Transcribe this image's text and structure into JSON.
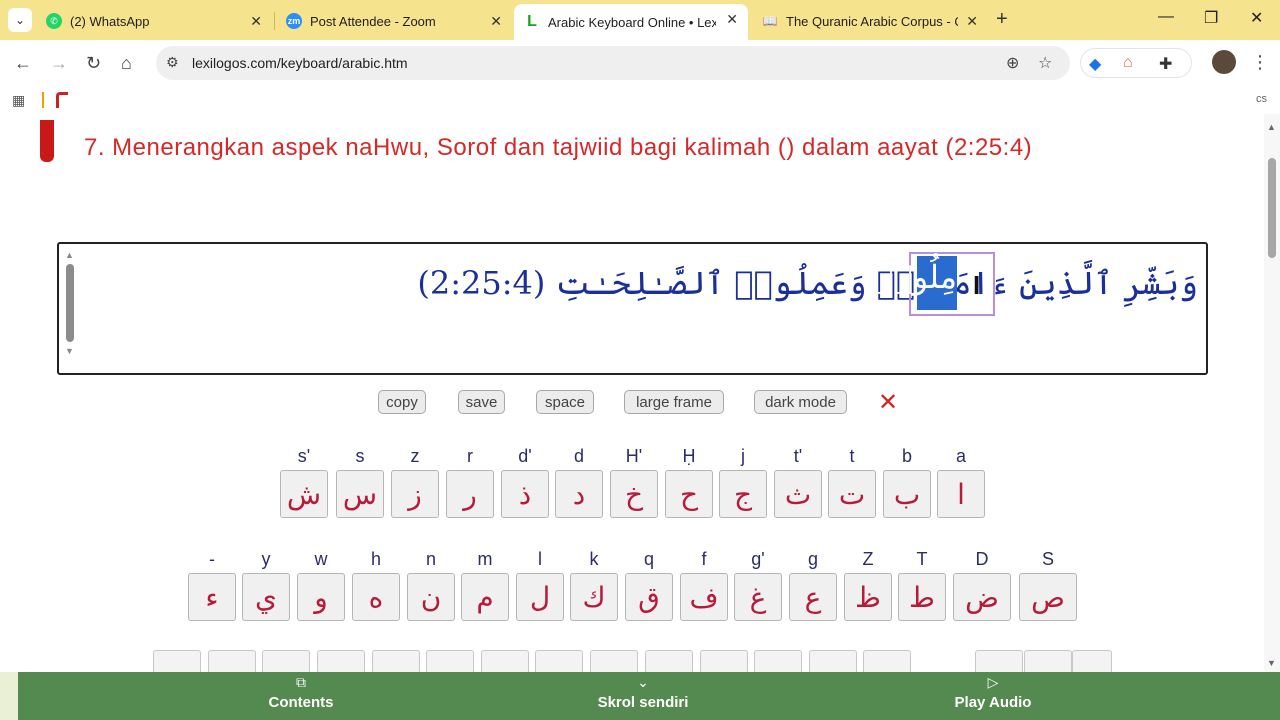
{
  "browser": {
    "tabs": [
      {
        "title": "(2) WhatsApp",
        "icon": "whatsapp-icon",
        "color": "#25d366",
        "active": false
      },
      {
        "title": "Post Attendee - Zoom",
        "icon": "zoom-icon",
        "color": "#2d8cff",
        "active": false
      },
      {
        "title": "Arabic Keyboard Online • Lexilo",
        "icon": "lexilogos-icon",
        "color": "#1aa31a",
        "active": true
      },
      {
        "title": "The Quranic Arabic Corpus - Qu",
        "icon": "corpus-icon",
        "color": "#666666",
        "active": false
      }
    ],
    "url": "lexilogos.com/keyboard/arabic.htm",
    "bookmark_right_text": "cs"
  },
  "page": {
    "heading": "7. Menerangkan aspek naHwu, Sorof dan tajwiid bagi kalimah () dalam aayat (2:25:4)",
    "editor_text": "وَبَشِّرِ ٱلَّذِينَ ءَامَنُوا۟ وَعَمِلُوا۟ ٱلصَّـٰلِحَـٰتِ (2:25:4)",
    "selected_word": "مِلُوا۟",
    "buttons": {
      "copy": "copy",
      "save": "save",
      "space": "space",
      "large_frame": "large frame",
      "dark_mode": "dark mode",
      "close": "✕"
    },
    "keyboard_row1": [
      {
        "lat": "s'",
        "ar": "ش"
      },
      {
        "lat": "s",
        "ar": "س"
      },
      {
        "lat": "z",
        "ar": "ز"
      },
      {
        "lat": "r",
        "ar": "ر"
      },
      {
        "lat": "d'",
        "ar": "ذ"
      },
      {
        "lat": "d",
        "ar": "د"
      },
      {
        "lat": "H'",
        "ar": "خ"
      },
      {
        "lat": "Ḥ",
        "ar": "ح"
      },
      {
        "lat": "j",
        "ar": "ج"
      },
      {
        "lat": "t'",
        "ar": "ث"
      },
      {
        "lat": "t",
        "ar": "ت"
      },
      {
        "lat": "b",
        "ar": "ب"
      },
      {
        "lat": "a",
        "ar": "ا"
      }
    ],
    "keyboard_row2": [
      {
        "lat": "-",
        "ar": "ء"
      },
      {
        "lat": "y",
        "ar": "ي"
      },
      {
        "lat": "w",
        "ar": "و"
      },
      {
        "lat": "h",
        "ar": "ه"
      },
      {
        "lat": "n",
        "ar": "ن"
      },
      {
        "lat": "m",
        "ar": "م"
      },
      {
        "lat": "l",
        "ar": "ل"
      },
      {
        "lat": "k",
        "ar": "ك"
      },
      {
        "lat": "q",
        "ar": "ق"
      },
      {
        "lat": "f",
        "ar": "ف"
      },
      {
        "lat": "g'",
        "ar": "غ"
      },
      {
        "lat": "g",
        "ar": "ع"
      },
      {
        "lat": "Z",
        "ar": "ظ"
      },
      {
        "lat": "T",
        "ar": "ط"
      },
      {
        "lat": "D",
        "ar": "ض"
      },
      {
        "lat": "S",
        "ar": "ص"
      }
    ]
  },
  "bottom_bar": {
    "contents": "Contents",
    "scroll": "Skrol sendiri",
    "audio": "Play Audio"
  }
}
